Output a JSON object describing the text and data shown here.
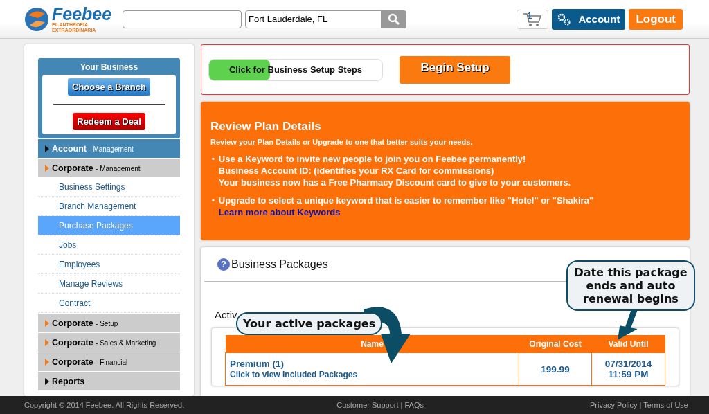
{
  "header": {
    "logo": {
      "name": "Feebee",
      "tagline_1": "FILANTHROPIA",
      "tagline_2": "EXTRAORDINARIA"
    },
    "location": {
      "value": "Fort Lauderdale, FL"
    },
    "cart_count": "1",
    "account_label": "Account",
    "logout_label": "Logout"
  },
  "sidebar": {
    "business_box": {
      "title": "Your Business",
      "choose_branch": "Choose a Branch",
      "redeem_deal": "Redeem a Deal"
    },
    "menu": [
      {
        "kind": "header",
        "label": "Account",
        "suffix": "- Management",
        "selected": true,
        "color": "#111111"
      },
      {
        "kind": "header",
        "label": "Corporate",
        "suffix": "- Management",
        "selected": false,
        "color": "#f07a1a"
      },
      {
        "kind": "item",
        "label": "Business Settings",
        "selected": false
      },
      {
        "kind": "item",
        "label": "Branch Management",
        "selected": false
      },
      {
        "kind": "item",
        "label": "Purchase Packages",
        "selected": true
      },
      {
        "kind": "item",
        "label": "Jobs",
        "selected": false
      },
      {
        "kind": "item",
        "label": "Employees",
        "selected": false
      },
      {
        "kind": "item",
        "label": "Manage Reviews",
        "selected": false
      },
      {
        "kind": "item",
        "label": "Contract",
        "selected": false
      },
      {
        "kind": "header",
        "label": "Corporate",
        "suffix": "- Setup",
        "selected": false,
        "color": "#f07a1a"
      },
      {
        "kind": "header",
        "label": "Corporate",
        "suffix": "- Sales & Marketing",
        "selected": false,
        "color": "#f07a1a"
      },
      {
        "kind": "header",
        "label": "Corporate",
        "suffix": "- Financial",
        "selected": false,
        "color": "#f07a1a"
      },
      {
        "kind": "header",
        "label": "Reports",
        "selected": false,
        "color": "#111111"
      }
    ]
  },
  "setup": {
    "steps": {
      "label": "Click for Business Setup Steps",
      "level": 0.35
    },
    "begin_button": "Begin Setup"
  },
  "plan": {
    "title": "Review Plan Details",
    "subtitle": "Review your Plan Details or Upgrade to one that better suits your needs.",
    "bullets": [
      {
        "marker": "•",
        "lines": [
          "Use a Keyword to invite new people to join you on Feebee permanently!",
          "Business Account ID: (identifies your RX Card for commissions)",
          "Your business now has a Free Pharmacy Discount card to give to your customers."
        ]
      },
      {
        "marker": "•",
        "lines": [
          "Upgrade to select a unique keyword that is easier to remember like \"Hotel\" or \"Shakira\""
        ],
        "link": "Learn more about Keywords"
      }
    ]
  },
  "packages": {
    "help_icon": "?",
    "title": "Business Packages",
    "section_title": "Activ",
    "table": {
      "columns": [
        "Name",
        "Original Cost",
        "Valid Until"
      ],
      "rows": [
        {
          "name": "Premium (1)",
          "link": "Click to view Included Packages",
          "cost": "199.99",
          "valid_date": "07/31/2014",
          "valid_time": "11:59 PM"
        }
      ]
    },
    "callouts": [
      "Your active packages",
      "Date this package ends and auto renewal begins"
    ]
  },
  "footer": {
    "copyright": "Copyright © 2014 Feebee. All Rights Reserved.",
    "separator": "|",
    "links_center": [
      "Customer Support",
      "FAQs"
    ],
    "links_right": [
      "Privacy Policy",
      "Terms of Use"
    ]
  }
}
